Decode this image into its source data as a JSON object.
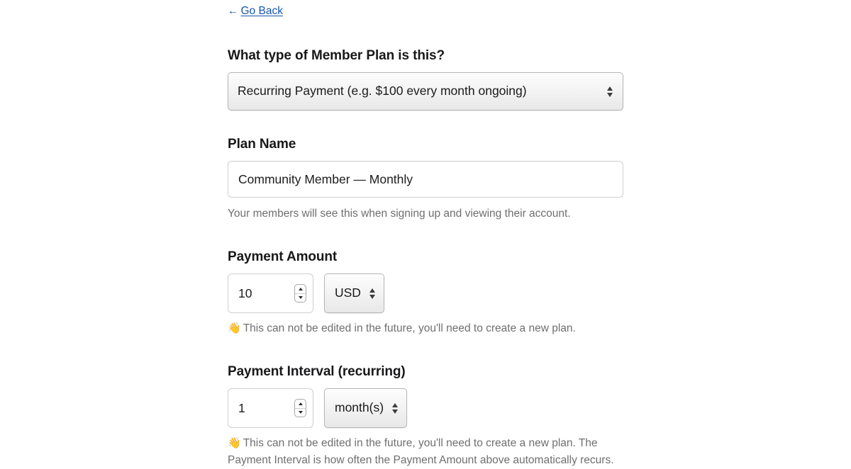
{
  "nav": {
    "back_link_label": "Go Back",
    "back_arrow_glyph": "←",
    "link_color": "#1756a9"
  },
  "form": {
    "plan_type": {
      "label": "What type of Member Plan is this?",
      "selected_option": "Recurring Payment (e.g. $100 every month ongoing)"
    },
    "plan_name": {
      "label": "Plan Name",
      "value": "Community Member — Monthly",
      "placeholder": "",
      "helper": "Your members will see this when signing up and viewing their account."
    },
    "payment_amount": {
      "label": "Payment Amount",
      "value": "10",
      "currency": "USD",
      "helper_emoji": "👋",
      "helper": "This can not be edited in the future, you'll need to create a new plan."
    },
    "payment_interval": {
      "label": "Payment Interval (recurring)",
      "value": "1",
      "unit": "month(s)",
      "helper_emoji": "👋",
      "helper": "This can not be edited in the future, you'll need to create a new plan. The Payment Interval is how often the Payment Amount above automatically recurs."
    }
  }
}
